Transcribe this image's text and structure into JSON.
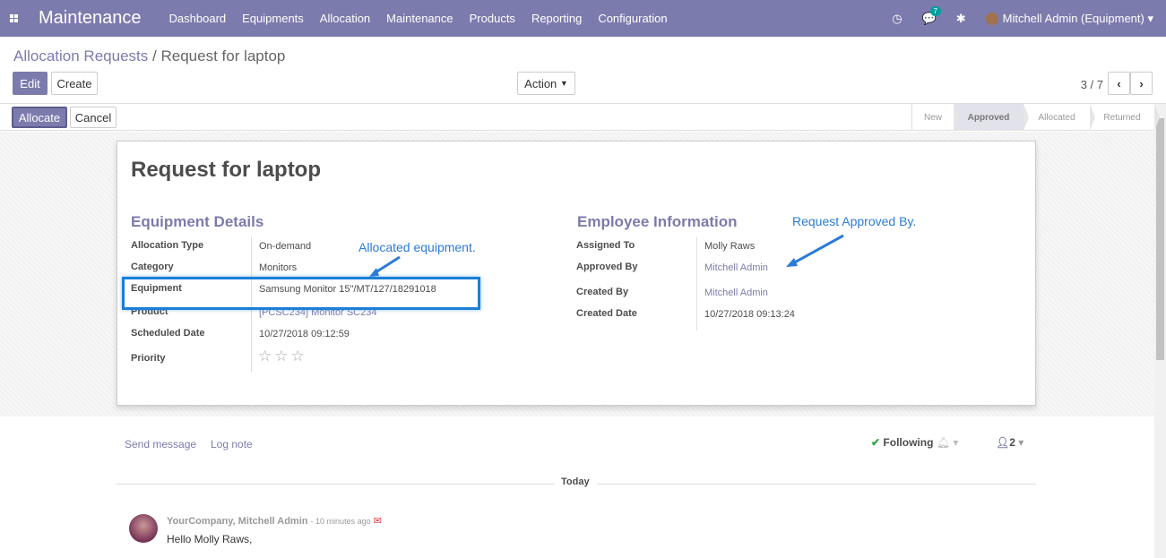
{
  "topbar": {
    "brand": "Maintenance",
    "menu": [
      "Dashboard",
      "Equipments",
      "Allocation",
      "Maintenance",
      "Products",
      "Reporting",
      "Configuration"
    ],
    "chat_count": "7",
    "user": "Mitchell Admin (Equipment)"
  },
  "breadcrumb": {
    "parent": "Allocation Requests",
    "sep": "/",
    "current": "Request for laptop"
  },
  "buttons": {
    "edit": "Edit",
    "create": "Create",
    "action": "Action",
    "allocate": "Allocate",
    "cancel": "Cancel"
  },
  "pager": {
    "value": "3 / 7"
  },
  "stages": [
    "New",
    "Approved",
    "Allocated",
    "Returned"
  ],
  "active_stage": "Approved",
  "form": {
    "title": "Request for laptop",
    "left_section": "Equipment Details",
    "right_section": "Employee Information",
    "left": [
      {
        "label": "Allocation Type",
        "value": "On-demand"
      },
      {
        "label": "Category",
        "value": "Monitors"
      },
      {
        "label": "Equipment",
        "value": "Samsung Monitor 15\"/MT/127/18291018"
      },
      {
        "label": "Product",
        "value": "[PCSC234] Monitor SC234"
      },
      {
        "label": "Scheduled Date",
        "value": "10/27/2018 09:12:59"
      },
      {
        "label": "Priority",
        "value": "☆☆☆"
      }
    ],
    "right": [
      {
        "label": "Assigned To",
        "value": "Molly Raws"
      },
      {
        "label": "Approved By",
        "value": "Mitchell Admin"
      },
      {
        "label": "Created By",
        "value": "Mitchell Admin"
      },
      {
        "label": "Created Date",
        "value": "10/27/2018 09:13:24"
      }
    ]
  },
  "annotations": {
    "allocated": "Allocated equipment.",
    "approved": "Request Approved By."
  },
  "chatter": {
    "send_message": "Send message",
    "log_note": "Log note",
    "following": "Following",
    "followers": "2",
    "today": "Today",
    "author": "YourCompany, Mitchell Admin",
    "ago": "- 10 minutes ago",
    "body": "Hello Molly Raws,"
  },
  "colors": {
    "brand": "#7c7bad",
    "annotation": "#2b7bd8"
  }
}
